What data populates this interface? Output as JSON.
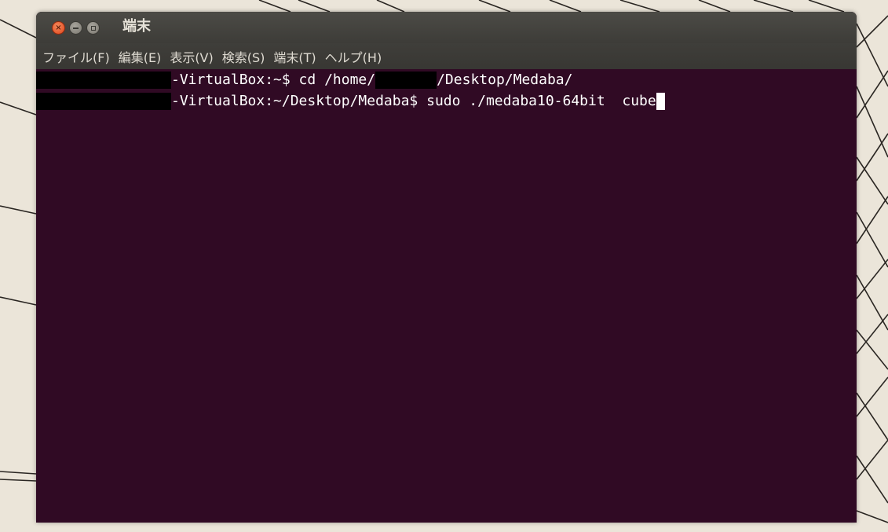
{
  "window": {
    "title": "端末",
    "controls": {
      "close_icon": "close-icon",
      "close_glyph": "×",
      "minimize_icon": "minimize-icon",
      "maximize_icon": "maximize-icon"
    }
  },
  "menubar": {
    "items": [
      {
        "label": "ファイル(F)"
      },
      {
        "label": "編集(E)"
      },
      {
        "label": "表示(V)"
      },
      {
        "label": "検索(S)"
      },
      {
        "label": "端末(T)"
      },
      {
        "label": "ヘルプ(H)"
      }
    ]
  },
  "terminal": {
    "colors": {
      "background": "#300a24",
      "text": "#ffffff",
      "redaction": "#000000"
    },
    "lines": [
      {
        "prompt_suffix": "-VirtualBox:~$ cd /home/",
        "path_suffix": "/Desktop/Medaba/"
      },
      {
        "prompt_suffix": "-VirtualBox:~/Desktop/Medaba$ sudo ./medaba10-64bit  cube"
      }
    ]
  }
}
